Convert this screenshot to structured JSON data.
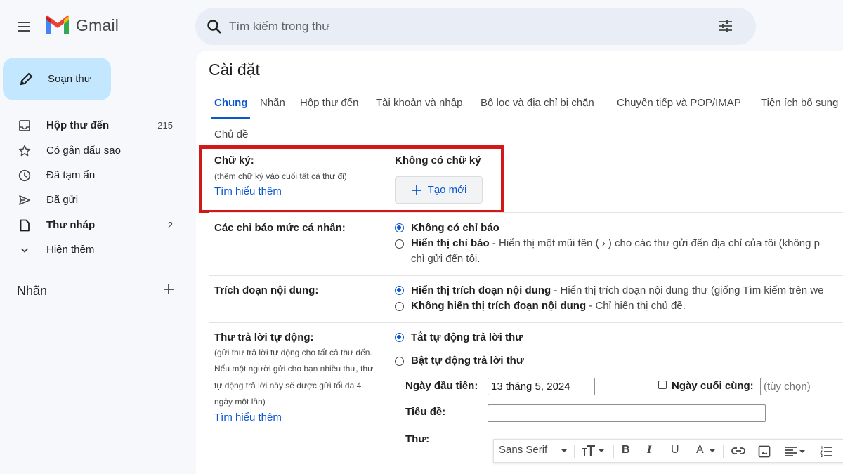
{
  "app": {
    "name": "Gmail",
    "colors": {
      "accent": "#0b57d0",
      "compose_bg": "#c2e7ff",
      "highlight": "#d31818"
    }
  },
  "search": {
    "placeholder": "Tìm kiếm trong thư"
  },
  "sidebar": {
    "compose_label": "Soạn thư",
    "items": [
      {
        "icon": "inbox-icon",
        "label": "Hộp thư đến",
        "count": "215",
        "bold": true
      },
      {
        "icon": "star-icon",
        "label": "Có gắn dấu sao",
        "count": ""
      },
      {
        "icon": "clock-icon",
        "label": "Đã tạm ẩn",
        "count": ""
      },
      {
        "icon": "send-icon",
        "label": "Đã gửi",
        "count": ""
      },
      {
        "icon": "draft-icon",
        "label": "Thư nháp",
        "count": "2",
        "bold": true
      },
      {
        "icon": "chevron-down-icon",
        "label": "Hiện thêm",
        "count": ""
      }
    ],
    "labels_heading": "Nhãn"
  },
  "settings": {
    "title": "Cài đặt",
    "tabs": [
      "Chung",
      "Nhãn",
      "Hộp thư đến",
      "Tài khoản và nhập",
      "Bộ lọc và địa chỉ bị chặn",
      "Chuyển tiếp và POP/IMAP",
      "Tiện ích bổ sung"
    ],
    "active_tab": "Chung",
    "tab_row2": "Chủ đề",
    "signature": {
      "label": "Chữ ký:",
      "desc": "(thêm chữ ký vào cuối tất cả thư đi)",
      "learn_more": "Tìm hiểu thêm",
      "none": "Không có chữ ký",
      "new_button": "Tạo mới"
    },
    "personal_indicators": {
      "label": "Các chỉ báo mức cá nhân:",
      "opt1": "Không có chỉ báo",
      "opt2_bold": "Hiển thị chỉ báo",
      "opt2_desc": " - Hiển thị một mũi tên ( › ) cho các thư gửi đến địa chỉ của tôi (không p",
      "opt2_desc_line2": "chỉ gửi đến tôi."
    },
    "snippets": {
      "label": "Trích đoạn nội dung:",
      "opt1_bold": "Hiển thị trích đoạn nội dung",
      "opt1_desc": " - Hiển thị trích đoạn nội dung thư (giống Tìm kiếm trên we",
      "opt2_bold": "Không hiển thị trích đoạn nội dung",
      "opt2_desc": " - Chỉ hiển thị chủ đề."
    },
    "vacation": {
      "label": "Thư trả lời tự động:",
      "desc_lines": [
        "(gửi thư trả lời tự động cho tất cả thư đến.",
        "Nếu một người gửi cho bạn nhiều thư, thư",
        "tự động trả lời này sẽ được gửi tối đa 4",
        "ngày một lần)"
      ],
      "learn_more": "Tìm hiểu thêm",
      "off": "Tắt tự động trả lời thư",
      "on": "Bật tự động trả lời thư",
      "first_day_label": "Ngày đầu tiên:",
      "first_day_value": "13 tháng 5, 2024",
      "last_day_label": "Ngày cuối cùng:",
      "last_day_placeholder": "(tùy chọn)",
      "subject_label": "Tiêu đề:",
      "message_label": "Thư:"
    },
    "toolbar": {
      "font": "Sans Serif"
    }
  }
}
